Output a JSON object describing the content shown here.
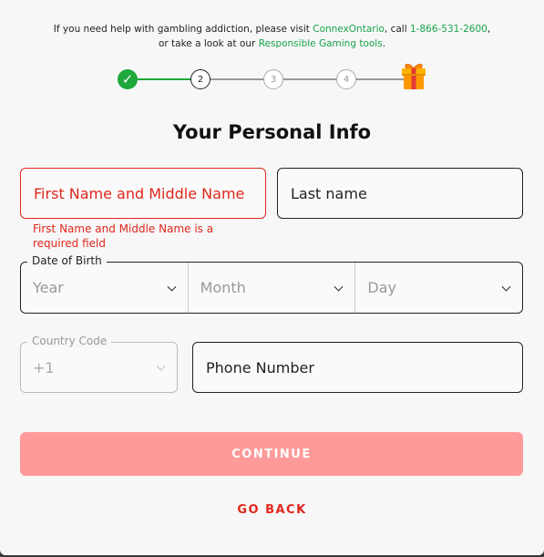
{
  "help": {
    "line1_prefix": "If you need help with gambling addiction, please visit ",
    "connex_link": "ConnexOntario",
    "line1_mid": ", call ",
    "phone_link": "1-866-531-2600",
    "line1_suffix": ",",
    "line2_prefix": "or take a look at our ",
    "tools_link": "Responsible Gaming tools",
    "line2_suffix": "."
  },
  "stepper": {
    "steps": [
      {
        "label": "✓",
        "state": "done"
      },
      {
        "label": "2",
        "state": "current"
      },
      {
        "label": "3",
        "state": "todo"
      },
      {
        "label": "4",
        "state": "todo"
      }
    ],
    "final_icon": "gift-icon"
  },
  "form": {
    "title": "Your Personal Info",
    "first_name_placeholder": "First Name and Middle Name",
    "first_name_error": "First Name and Middle Name is a required field",
    "last_name_placeholder": "Last name",
    "dob_label": "Date of Birth",
    "year_placeholder": "Year",
    "month_placeholder": "Month",
    "day_placeholder": "Day",
    "country_code_label": "Country Code",
    "country_code_value": "+1",
    "phone_placeholder": "Phone Number"
  },
  "actions": {
    "continue_label": "CONTINUE",
    "go_back_label": "GO BACK"
  },
  "colors": {
    "accent_green": "#18a34a",
    "error_red": "#e0271c",
    "continue_disabled": "#ff9a9a"
  }
}
